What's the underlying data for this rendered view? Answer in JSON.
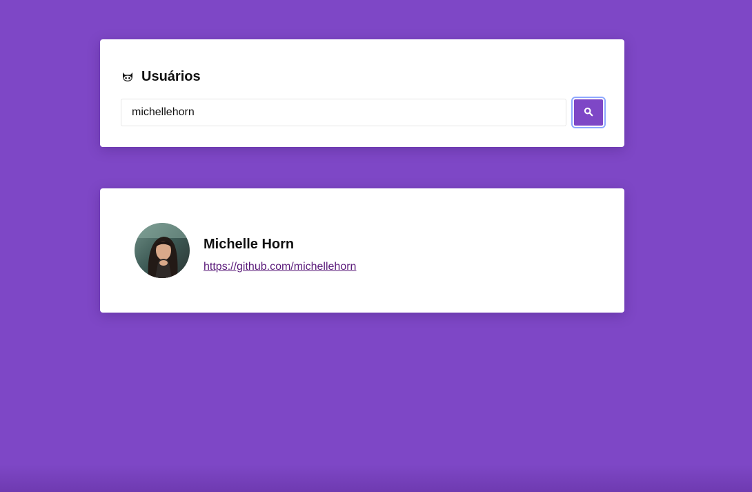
{
  "search_panel": {
    "title": "Usuários",
    "title_icon": "github-icon",
    "input_value": "michellehorn",
    "button_icon": "search-icon"
  },
  "result": {
    "name": "Michelle Horn",
    "profile_url": "https://github.com/michellehorn",
    "avatar": "avatar-photo"
  },
  "colors": {
    "background": "#7e47c6",
    "button": "#7e47c6",
    "link": "#5a1a7a",
    "focus_ring": "#8ea8ff"
  }
}
